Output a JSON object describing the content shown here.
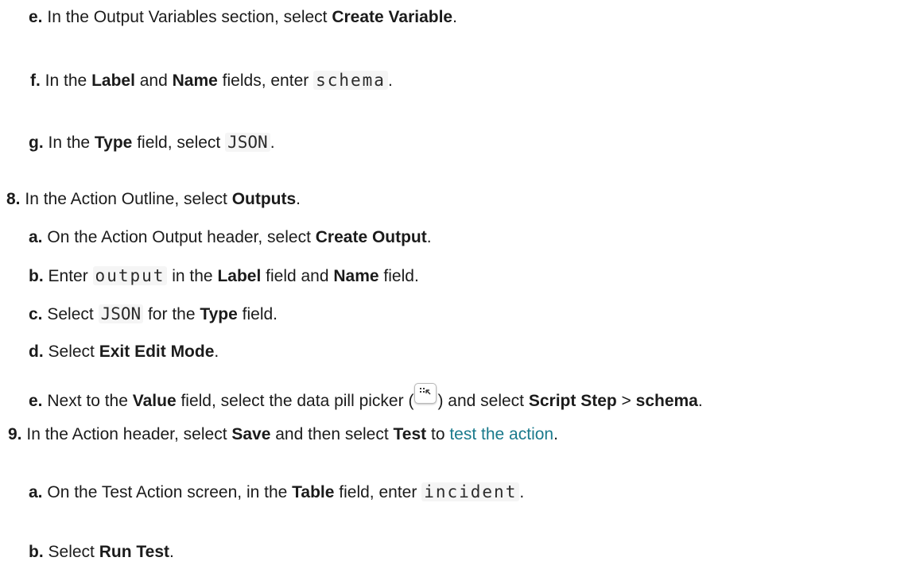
{
  "steps": [
    {
      "marker": "e.",
      "pre": "In the Output Variables section, select ",
      "bold1": "Create Variable",
      "post": "."
    },
    {
      "marker": "f.",
      "pre": "In the ",
      "bold1": "Label",
      "mid1": " and ",
      "bold2": "Name",
      "mid2": " fields, enter ",
      "code": "schema",
      "post": "."
    },
    {
      "marker": "g.",
      "pre": "In the ",
      "bold1": "Type",
      "mid1": " field, select ",
      "code": "JSON",
      "post": "."
    },
    {
      "marker": "8.",
      "pre": "In the Action Outline, select ",
      "bold1": "Outputs",
      "post": "."
    },
    {
      "marker": "a.",
      "pre": "On the Action Output header, select ",
      "bold1": "Create Output",
      "post": "."
    },
    {
      "marker": "b.",
      "pre": "Enter ",
      "code": "output",
      "mid1": " in the ",
      "bold1": "Label",
      "mid2": " field and ",
      "bold2": "Name",
      "post": " field."
    },
    {
      "marker": "c.",
      "pre": "Select ",
      "code": "JSON",
      "mid1": " for the ",
      "bold1": "Type",
      "post": " field."
    },
    {
      "marker": "d.",
      "pre": "Select ",
      "bold1": "Exit Edit Mode",
      "post": "."
    },
    {
      "marker": "e.",
      "pre": "Next to the ",
      "bold1": "Value",
      "mid1": " field, select the data pill picker (",
      "mid2": ") and select ",
      "bold2": "Script Step",
      "mid3": " > ",
      "bold3": "schema",
      "post": "."
    },
    {
      "marker": "9.",
      "pre": "In the Action header, select ",
      "bold1": "Save",
      "mid1": " and then select ",
      "bold2": "Test",
      "mid2": " to ",
      "link": "test the action",
      "post": "."
    },
    {
      "marker": "a.",
      "pre": "On the Test Action screen, in the ",
      "bold1": "Table",
      "mid1": " field, enter ",
      "code": "incident",
      "post": "."
    },
    {
      "marker": "b.",
      "pre": "Select ",
      "bold1": "Run Test",
      "post": "."
    }
  ],
  "colors": {
    "text": "#1b1b1b",
    "link": "#1a7a8c",
    "code_bg": "#f5f5f5"
  },
  "icons": {
    "data_pill_picker": "data-pill-picker-icon"
  }
}
